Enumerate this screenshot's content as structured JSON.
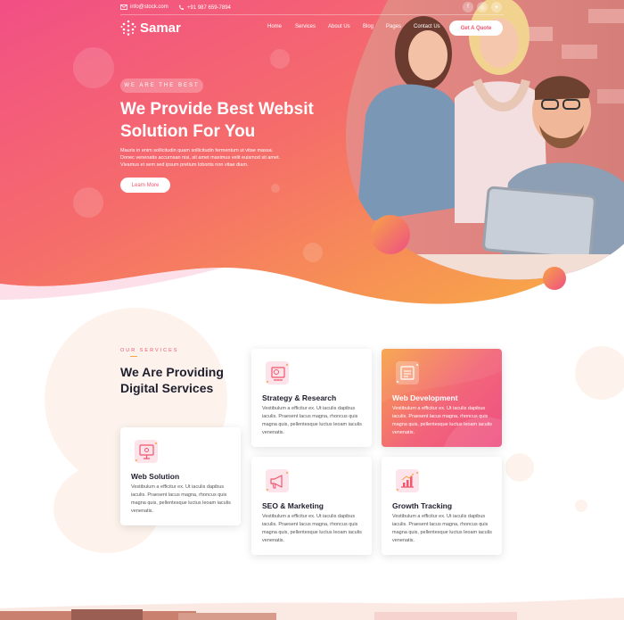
{
  "topbar": {
    "email": "info@stock.com",
    "phone": "+91 987 659-7894",
    "social_icons": [
      "facebook-icon",
      "instagram-icon",
      "twitter-icon"
    ]
  },
  "brand": {
    "name": "Samar"
  },
  "nav": {
    "items": [
      "Home",
      "Services",
      "About Us",
      "Blog",
      "Pages",
      "Contact Us"
    ],
    "cta": "Get A Quote"
  },
  "hero": {
    "tag": "WE ARE THE BEST",
    "title_line1": "We Provide Best Websit",
    "title_line2": "Solution For You",
    "desc_line1": "Mauris in enim sollicitudin quam sollicitudin fermentum ut vitae massa.",
    "desc_line2": "Donec venenatis accumsan nisi, sit amet maximus velit euismod sit amet.",
    "desc_line3": "Vivamus et sem sed ipsum pretium lobortis non vitae diam.",
    "button": "Learn More"
  },
  "services": {
    "subtitle": "OUR SERVICES",
    "title_line1": "We Are Providing",
    "title_line2": "Digital Services",
    "cards": [
      {
        "title": "Strategy & Research",
        "text": "Vestibulum a efficitur ex. Ut iaculis dapibus iaculis. Praesent lacus magna, rhoncus quis magna quis, pellentesque luctus leoam iaculis venenatis.",
        "icon": "strategy-icon"
      },
      {
        "title": "Web Development",
        "text": "Vestibulum a efficitur ex. Ut iaculis dapibus iaculis. Praesent lacus magna, rhoncus quis magna quis, pellentesque luctus leoam iaculis venenatis.",
        "icon": "web-development-icon"
      },
      {
        "title": "Web Solution",
        "text": "Vestibulum a efficitur ex. Ut iaculis dapibus iaculis. Praesent lacus magna, rhoncus quis magna quis, pellentesque luctus leoam iaculis venenatis.",
        "icon": "web-solution-icon"
      },
      {
        "title": "SEO & Marketing",
        "text": "Vestibulum a efficitur ex. Ut iaculis dapibus iaculis. Praesent lacus magna, rhoncus quis magna quis, pellentesque luctus leoam iaculis venenatis.",
        "icon": "megaphone-icon"
      },
      {
        "title": "Growth Tracking",
        "text": "Vestibulum a efficitur ex. Ut iaculis dapibus iaculis. Praesent lacus magna, rhoncus quis magna quis, pellentesque luctus leoam iaculis venenatis.",
        "icon": "growth-chart-icon"
      }
    ]
  },
  "colors": {
    "gradient_pink": "#f0566e",
    "gradient_orange": "#f7a348",
    "title_dark": "#1e1e2e"
  }
}
